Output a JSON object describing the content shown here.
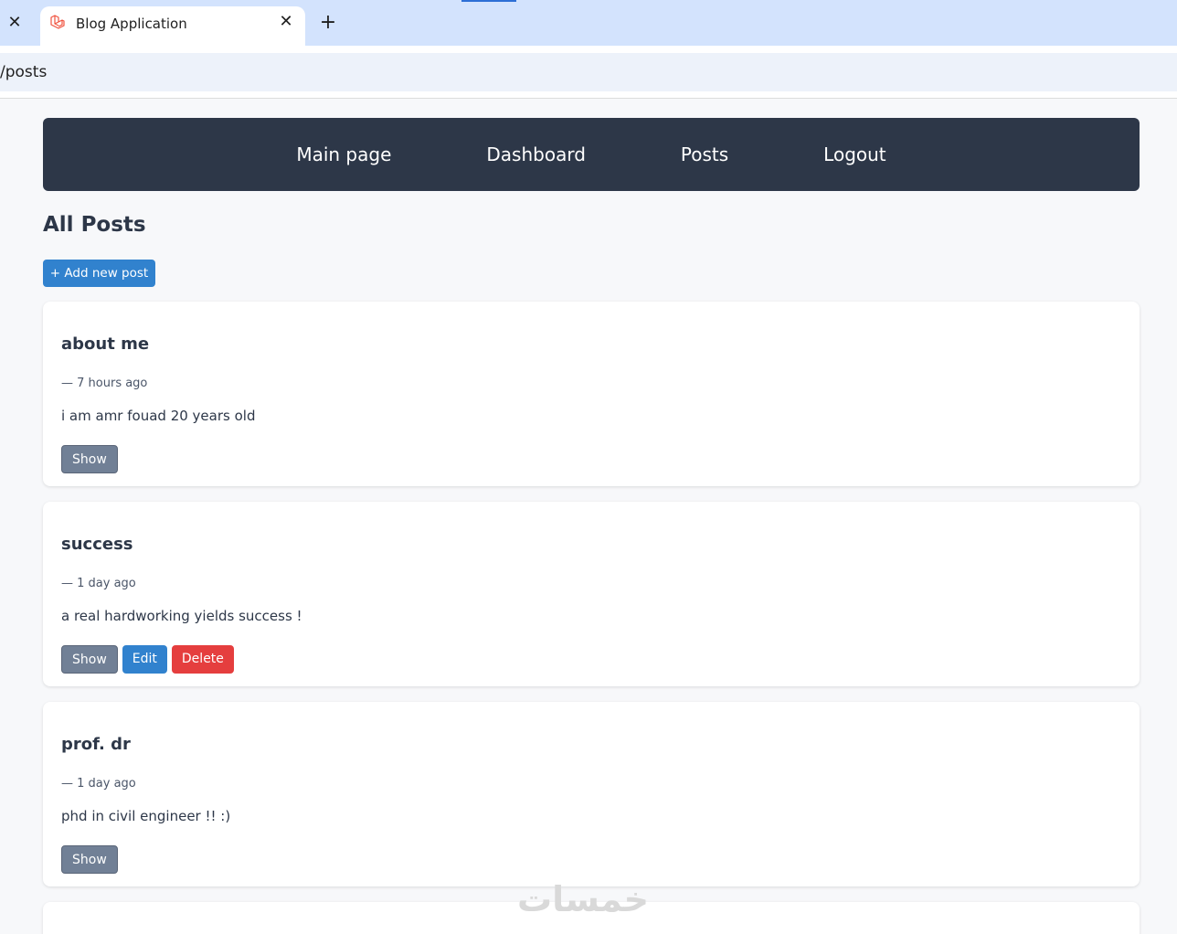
{
  "browser": {
    "tab_title": "Blog Application",
    "url": "/posts",
    "new_tab_glyph": "+",
    "close_glyph": "✕"
  },
  "nav": {
    "items": [
      {
        "label": "Main page"
      },
      {
        "label": "Dashboard"
      },
      {
        "label": "Posts"
      },
      {
        "label": "Logout"
      }
    ]
  },
  "page": {
    "title": "All Posts",
    "add_button": "+ Add new post"
  },
  "posts": [
    {
      "title": "about me",
      "meta": "— 7 hours ago",
      "body": "i am amr fouad 20 years old",
      "show": "Show"
    },
    {
      "title": "success",
      "meta": "— 1 day ago",
      "body": "a real hardworking yields success !",
      "show": "Show",
      "edit": "Edit",
      "delete": "Delete"
    },
    {
      "title": "prof. dr",
      "meta": "— 1 day ago",
      "body": "phd in civil engineer !! :)",
      "show": "Show"
    }
  ],
  "watermark": "خمسات",
  "colors": {
    "navbar": "#2d3748",
    "primary": "#3182ce",
    "danger": "#e53e3e",
    "secondary": "#718096",
    "tabstrip": "#d3e3fd"
  }
}
